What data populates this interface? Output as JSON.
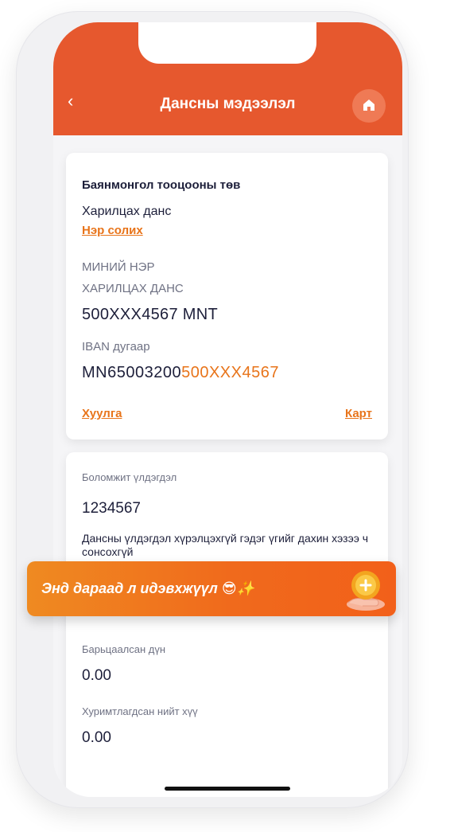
{
  "header": {
    "back_icon": "‹",
    "title": "Дансны мэдээлэл",
    "home_icon": "home-icon"
  },
  "account_card": {
    "bank_name": "Баянмонгол тооцооны төв",
    "account_type": "Харилцах данс",
    "rename_link": "Нэр солих",
    "owner_name": "МИНИЙ НЭР",
    "account_label": "ХАРИЛЦАХ ДАНС",
    "account_number": "500XXX4567 MNT",
    "iban_label": "IBAN дугаар",
    "iban_prefix": "MN65003200",
    "iban_suffix": "500XXX4567",
    "statement_link": "Хуулга",
    "card_link": "Карт"
  },
  "balance_card": {
    "available_label": "Боломжит үлдэгдэл",
    "available_value": "1234567",
    "note": "Дансны үлдэгдэл хүрэлцэхгүй гэдэг үгийг дахин хэзээ ч сонсохгүй",
    "pledged_label": "Барьцаалсан дүн",
    "pledged_value": "0.00",
    "interest_label": "Хуримтлагдсан нийт хүү",
    "interest_value": "0.00"
  },
  "banner": {
    "text": "Энд дараад л идэвхжүүл 😎✨",
    "icon": "coin-hand-icon"
  },
  "colors": {
    "accent": "#e6582e",
    "link": "#e8741a",
    "text": "#1d1f3a",
    "muted": "#6f7284"
  }
}
